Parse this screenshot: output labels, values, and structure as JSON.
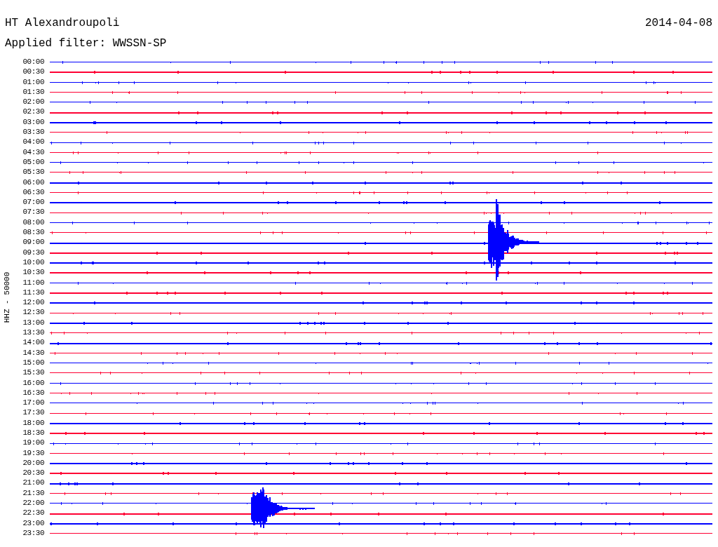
{
  "header": {
    "station": "HT Alexandroupoli",
    "date": "2014-04-08",
    "filter": "Applied filter: WWSSN-SP"
  },
  "plot": {
    "axis_label": "HHZ - 50000",
    "traces": [
      {
        "time": "00:00",
        "color": "#0000ff"
      },
      {
        "time": "00:30",
        "color": "#ff0033"
      },
      {
        "time": "01:00",
        "color": "#0000ff"
      },
      {
        "time": "01:30",
        "color": "#ff0033"
      },
      {
        "time": "02:00",
        "color": "#0000ff"
      },
      {
        "time": "02:30",
        "color": "#ff0033"
      },
      {
        "time": "03:00",
        "color": "#0000ff"
      },
      {
        "time": "03:30",
        "color": "#ff0033"
      },
      {
        "time": "04:00",
        "color": "#0000ff"
      },
      {
        "time": "04:30",
        "color": "#ff0033"
      },
      {
        "time": "05:00",
        "color": "#0000ff"
      },
      {
        "time": "05:30",
        "color": "#ff0033"
      },
      {
        "time": "06:00",
        "color": "#0000ff"
      },
      {
        "time": "06:30",
        "color": "#ff0033"
      },
      {
        "time": "07:00",
        "color": "#0000ff"
      },
      {
        "time": "07:30",
        "color": "#ff0033"
      },
      {
        "time": "08:00",
        "color": "#0000ff"
      },
      {
        "time": "08:30",
        "color": "#ff0033"
      },
      {
        "time": "09:00",
        "color": "#0000ff"
      },
      {
        "time": "09:30",
        "color": "#ff0033"
      },
      {
        "time": "10:00",
        "color": "#0000ff"
      },
      {
        "time": "10:30",
        "color": "#ff0033"
      },
      {
        "time": "11:00",
        "color": "#0000ff"
      },
      {
        "time": "11:30",
        "color": "#ff0033"
      },
      {
        "time": "12:00",
        "color": "#0000ff"
      },
      {
        "time": "12:30",
        "color": "#ff0033"
      },
      {
        "time": "13:00",
        "color": "#0000ff"
      },
      {
        "time": "13:30",
        "color": "#ff0033"
      },
      {
        "time": "14:00",
        "color": "#0000ff"
      },
      {
        "time": "14:30",
        "color": "#ff0033"
      },
      {
        "time": "15:00",
        "color": "#0000ff"
      },
      {
        "time": "15:30",
        "color": "#ff0033"
      },
      {
        "time": "16:00",
        "color": "#0000ff"
      },
      {
        "time": "16:30",
        "color": "#ff0033"
      },
      {
        "time": "17:00",
        "color": "#0000ff"
      },
      {
        "time": "17:30",
        "color": "#ff0033"
      },
      {
        "time": "18:00",
        "color": "#0000ff"
      },
      {
        "time": "18:30",
        "color": "#ff0033"
      },
      {
        "time": "19:00",
        "color": "#0000ff"
      },
      {
        "time": "19:30",
        "color": "#ff0033"
      },
      {
        "time": "20:00",
        "color": "#0000ff"
      },
      {
        "time": "20:30",
        "color": "#ff0033"
      },
      {
        "time": "21:00",
        "color": "#0000ff"
      },
      {
        "time": "21:30",
        "color": "#ff0033"
      },
      {
        "time": "22:00",
        "color": "#0000ff"
      },
      {
        "time": "22:30",
        "color": "#ff0033"
      },
      {
        "time": "23:00",
        "color": "#0000ff"
      },
      {
        "time": "23:30",
        "color": "#ff0033"
      }
    ]
  }
}
